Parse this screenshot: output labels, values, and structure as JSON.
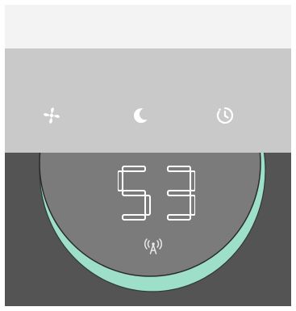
{
  "display": {
    "value": "53"
  },
  "controls": {
    "fan": {
      "icon": "fan-icon"
    },
    "sleep": {
      "icon": "moon-icon"
    },
    "timer": {
      "icon": "timer-icon"
    }
  },
  "status": {
    "icon": "wireless-signal-icon"
  },
  "colors": {
    "top_background": "#f3f3f4",
    "control_bar": "#c9c9ca",
    "bottom_panel": "#545455",
    "dial_face": "#7b7b7c",
    "dial_accent": "#9ddfc8",
    "icon_white": "#ffffff"
  }
}
